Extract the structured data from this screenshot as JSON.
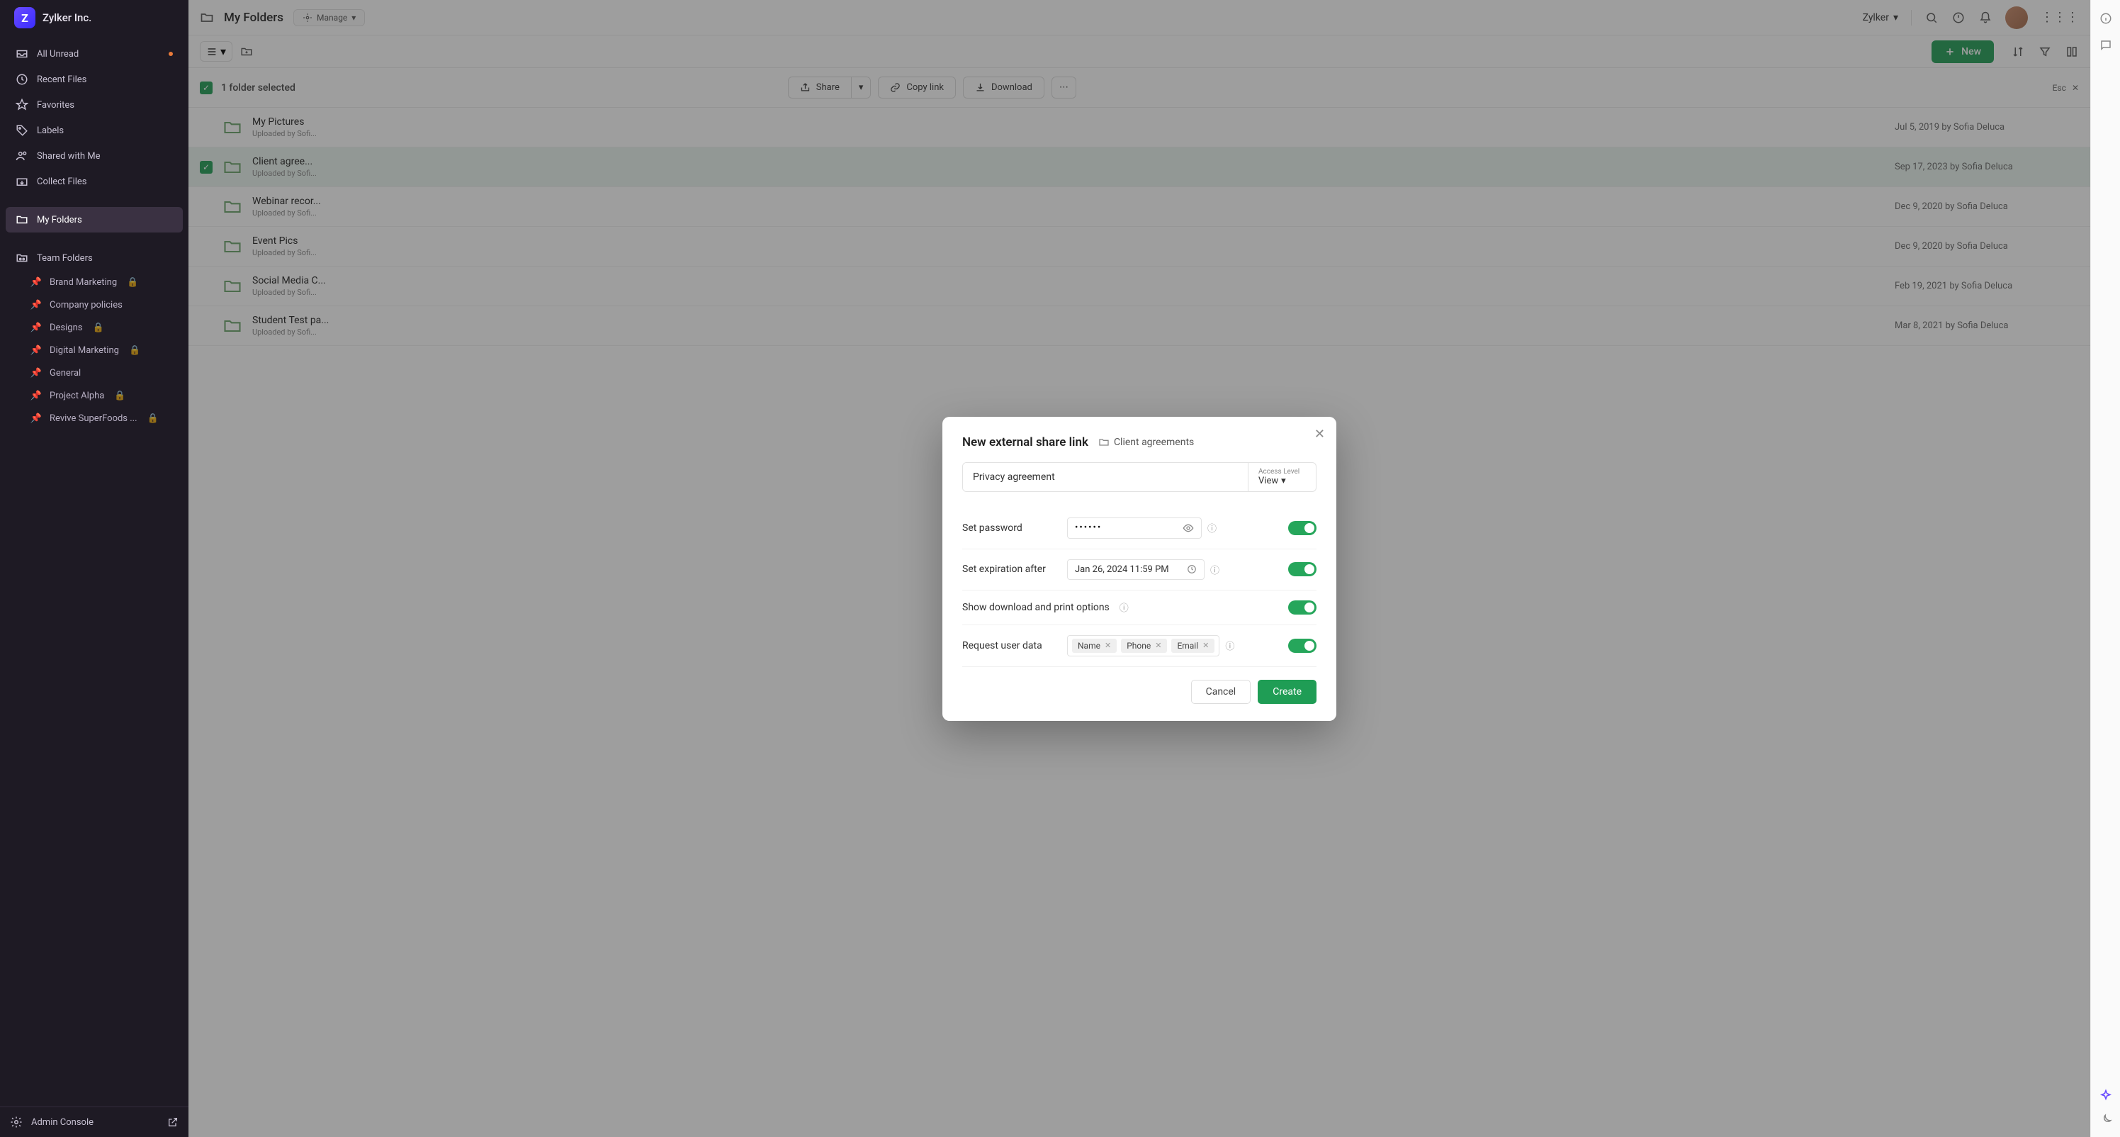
{
  "brand": {
    "logo_letter": "Z",
    "name": "Zylker Inc."
  },
  "sidebar": {
    "items": [
      {
        "label": "All Unread",
        "icon": "inbox"
      },
      {
        "label": "Recent Files",
        "icon": "clock"
      },
      {
        "label": "Favorites",
        "icon": "star"
      },
      {
        "label": "Labels",
        "icon": "tag"
      },
      {
        "label": "Shared with Me",
        "icon": "users"
      },
      {
        "label": "Collect Files",
        "icon": "collect"
      },
      {
        "label": "My Folders",
        "icon": "folder"
      }
    ],
    "team_header": "Team Folders",
    "team_items": [
      {
        "label": "Brand Marketing",
        "locked": true
      },
      {
        "label": "Company policies",
        "locked": false
      },
      {
        "label": "Designs",
        "locked": true
      },
      {
        "label": "Digital Marketing",
        "locked": true
      },
      {
        "label": "General",
        "locked": false
      },
      {
        "label": "Project Alpha",
        "locked": true
      },
      {
        "label": "Revive SuperFoods ...",
        "locked": true
      }
    ],
    "admin": "Admin Console"
  },
  "topbar": {
    "breadcrumb": "My Folders",
    "manage": "Manage",
    "org": "Zylker"
  },
  "toolbar": {
    "new": "New"
  },
  "selection_bar": {
    "summary": "1 folder selected",
    "share": "Share",
    "copy": "Copy link",
    "download": "Download",
    "esc": "Esc"
  },
  "files": [
    {
      "name": "My Pictures",
      "sub": "Uploaded by Sofi...",
      "meta": "Jul 5, 2019 by Sofia Deluca",
      "selected": false
    },
    {
      "name": "Client agree...",
      "sub": "Uploaded by Sofi...",
      "meta": "Sep 17, 2023 by Sofia Deluca",
      "selected": true
    },
    {
      "name": "Webinar recor...",
      "sub": "Uploaded by Sofi...",
      "meta": "Dec 9, 2020 by Sofia Deluca",
      "selected": false
    },
    {
      "name": "Event Pics",
      "sub": "Uploaded by Sofi...",
      "meta": "Dec 9, 2020 by Sofia Deluca",
      "selected": false
    },
    {
      "name": "Social Media C...",
      "sub": "Uploaded by Sofi...",
      "meta": "Feb 19, 2021 by Sofia Deluca",
      "selected": false
    },
    {
      "name": "Student Test pa...",
      "sub": "Uploaded by Sofi...",
      "meta": "Mar 8, 2021 by Sofia Deluca",
      "selected": false
    }
  ],
  "modal": {
    "title": "New external share link",
    "folder": "Client agreements",
    "link_name": "Privacy agreement",
    "access_label": "Access Level",
    "access_value": "View",
    "set_password_label": "Set password",
    "password_value": "••••••",
    "set_expiration_label": "Set expiration after",
    "expiration_value": "Jan 26, 2024 11:59 PM",
    "download_print_label": "Show download and print options",
    "request_user_label": "Request user data",
    "chips": [
      "Name",
      "Phone",
      "Email"
    ],
    "cancel": "Cancel",
    "create": "Create"
  }
}
